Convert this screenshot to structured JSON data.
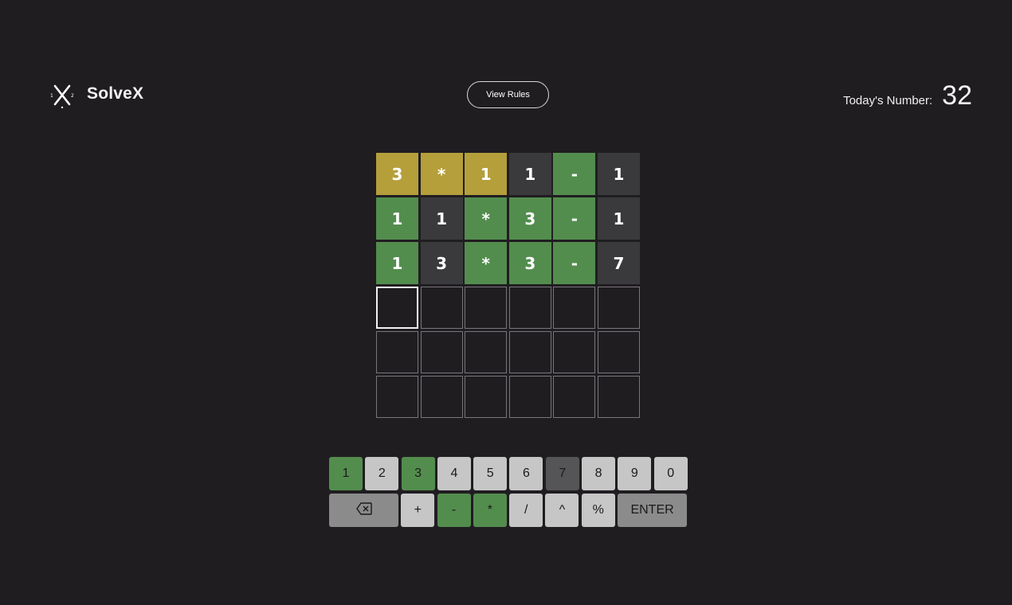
{
  "header": {
    "logo_icon": "solvex-x-logo-icon",
    "title": "SolveX",
    "rules_button": "View Rules",
    "today_label": "Today's Number:",
    "today_value": "32"
  },
  "colors": {
    "background": "#201d21",
    "correct": "#538d4e",
    "present": "#b59f3b",
    "absent": "#3a3a3c",
    "key_default": "#c6c6c6",
    "key_absent": "#555457"
  },
  "board": {
    "rows": [
      [
        {
          "char": "3",
          "state": "present"
        },
        {
          "char": "*",
          "state": "present"
        },
        {
          "char": "1",
          "state": "present"
        },
        {
          "char": "1",
          "state": "absent"
        },
        {
          "char": "-",
          "state": "correct"
        },
        {
          "char": "1",
          "state": "absent"
        }
      ],
      [
        {
          "char": "1",
          "state": "correct"
        },
        {
          "char": "1",
          "state": "absent"
        },
        {
          "char": "*",
          "state": "correct"
        },
        {
          "char": "3",
          "state": "correct"
        },
        {
          "char": "-",
          "state": "correct"
        },
        {
          "char": "1",
          "state": "absent"
        }
      ],
      [
        {
          "char": "1",
          "state": "correct"
        },
        {
          "char": "3",
          "state": "absent"
        },
        {
          "char": "*",
          "state": "correct"
        },
        {
          "char": "3",
          "state": "correct"
        },
        {
          "char": "-",
          "state": "correct"
        },
        {
          "char": "7",
          "state": "absent"
        }
      ],
      [
        {
          "char": "",
          "state": "active"
        },
        {
          "char": "",
          "state": "empty"
        },
        {
          "char": "",
          "state": "empty"
        },
        {
          "char": "",
          "state": "empty"
        },
        {
          "char": "",
          "state": "empty"
        },
        {
          "char": "",
          "state": "empty"
        }
      ],
      [
        {
          "char": "",
          "state": "empty"
        },
        {
          "char": "",
          "state": "empty"
        },
        {
          "char": "",
          "state": "empty"
        },
        {
          "char": "",
          "state": "empty"
        },
        {
          "char": "",
          "state": "empty"
        },
        {
          "char": "",
          "state": "empty"
        }
      ],
      [
        {
          "char": "",
          "state": "empty"
        },
        {
          "char": "",
          "state": "empty"
        },
        {
          "char": "",
          "state": "empty"
        },
        {
          "char": "",
          "state": "empty"
        },
        {
          "char": "",
          "state": "empty"
        },
        {
          "char": "",
          "state": "empty"
        }
      ]
    ]
  },
  "keyboard": {
    "rows": [
      [
        {
          "label": "1",
          "state": "correct",
          "name": "key-1"
        },
        {
          "label": "2",
          "state": "default",
          "name": "key-2"
        },
        {
          "label": "3",
          "state": "correct",
          "name": "key-3"
        },
        {
          "label": "4",
          "state": "default",
          "name": "key-4"
        },
        {
          "label": "5",
          "state": "default",
          "name": "key-5"
        },
        {
          "label": "6",
          "state": "default",
          "name": "key-6"
        },
        {
          "label": "7",
          "state": "absent",
          "name": "key-7"
        },
        {
          "label": "8",
          "state": "default",
          "name": "key-8"
        },
        {
          "label": "9",
          "state": "default",
          "name": "key-9"
        },
        {
          "label": "0",
          "state": "default",
          "name": "key-0"
        }
      ],
      [
        {
          "label": "",
          "state": "wide",
          "name": "backspace-key",
          "icon": "backspace-icon"
        },
        {
          "label": "+",
          "state": "default",
          "name": "key-plus"
        },
        {
          "label": "-",
          "state": "correct",
          "name": "key-minus"
        },
        {
          "label": "*",
          "state": "correct",
          "name": "key-multiply"
        },
        {
          "label": "/",
          "state": "default",
          "name": "key-divide"
        },
        {
          "label": "^",
          "state": "default",
          "name": "key-power"
        },
        {
          "label": "%",
          "state": "default",
          "name": "key-percent"
        },
        {
          "label": "ENTER",
          "state": "enter",
          "name": "enter-key"
        }
      ]
    ]
  }
}
